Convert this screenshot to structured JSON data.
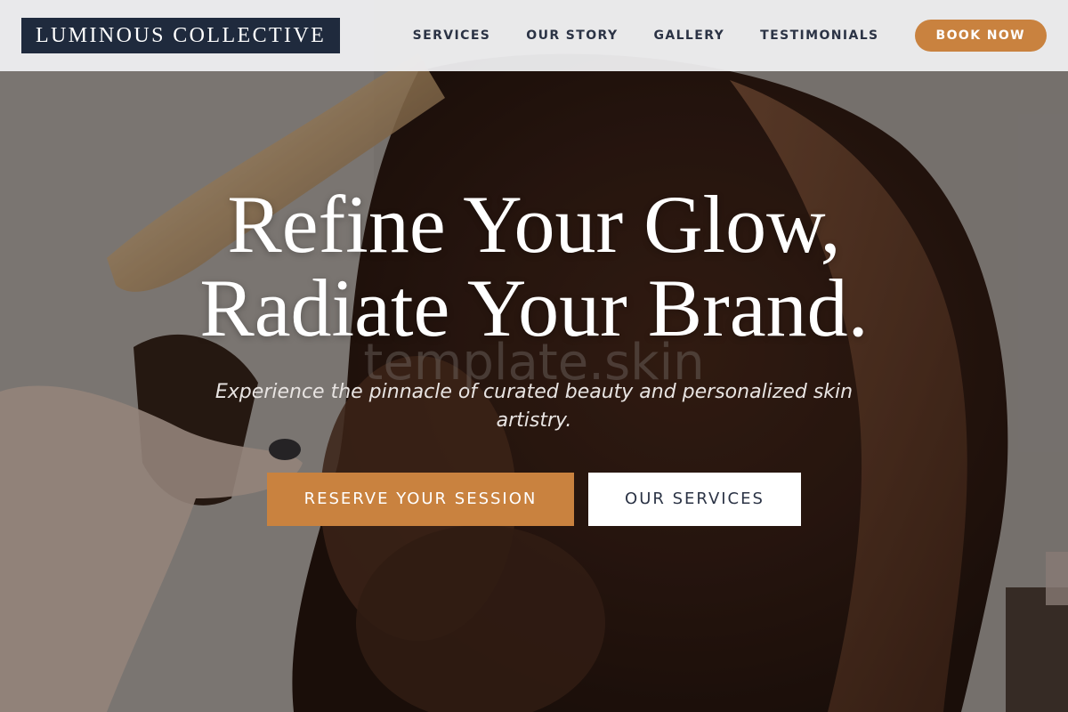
{
  "header": {
    "logo": "LUMINOUS COLLECTIVE",
    "nav": [
      {
        "label": "SERVICES"
      },
      {
        "label": "OUR STORY"
      },
      {
        "label": "GALLERY"
      },
      {
        "label": "TESTIMONIALS"
      }
    ],
    "book_button": "BOOK NOW"
  },
  "hero": {
    "headline_line1": "Refine Your Glow,",
    "headline_line2": "Radiate Your Brand.",
    "watermark": "template.skin",
    "subtitle": "Experience the pinnacle of curated beauty and personalized skin artistry.",
    "cta_primary": "RESERVE YOUR SESSION",
    "cta_secondary": "OUR SERVICES"
  },
  "colors": {
    "accent": "#c9823f",
    "brand_navy": "#1f2a3d",
    "nav_text": "#2b3345"
  }
}
